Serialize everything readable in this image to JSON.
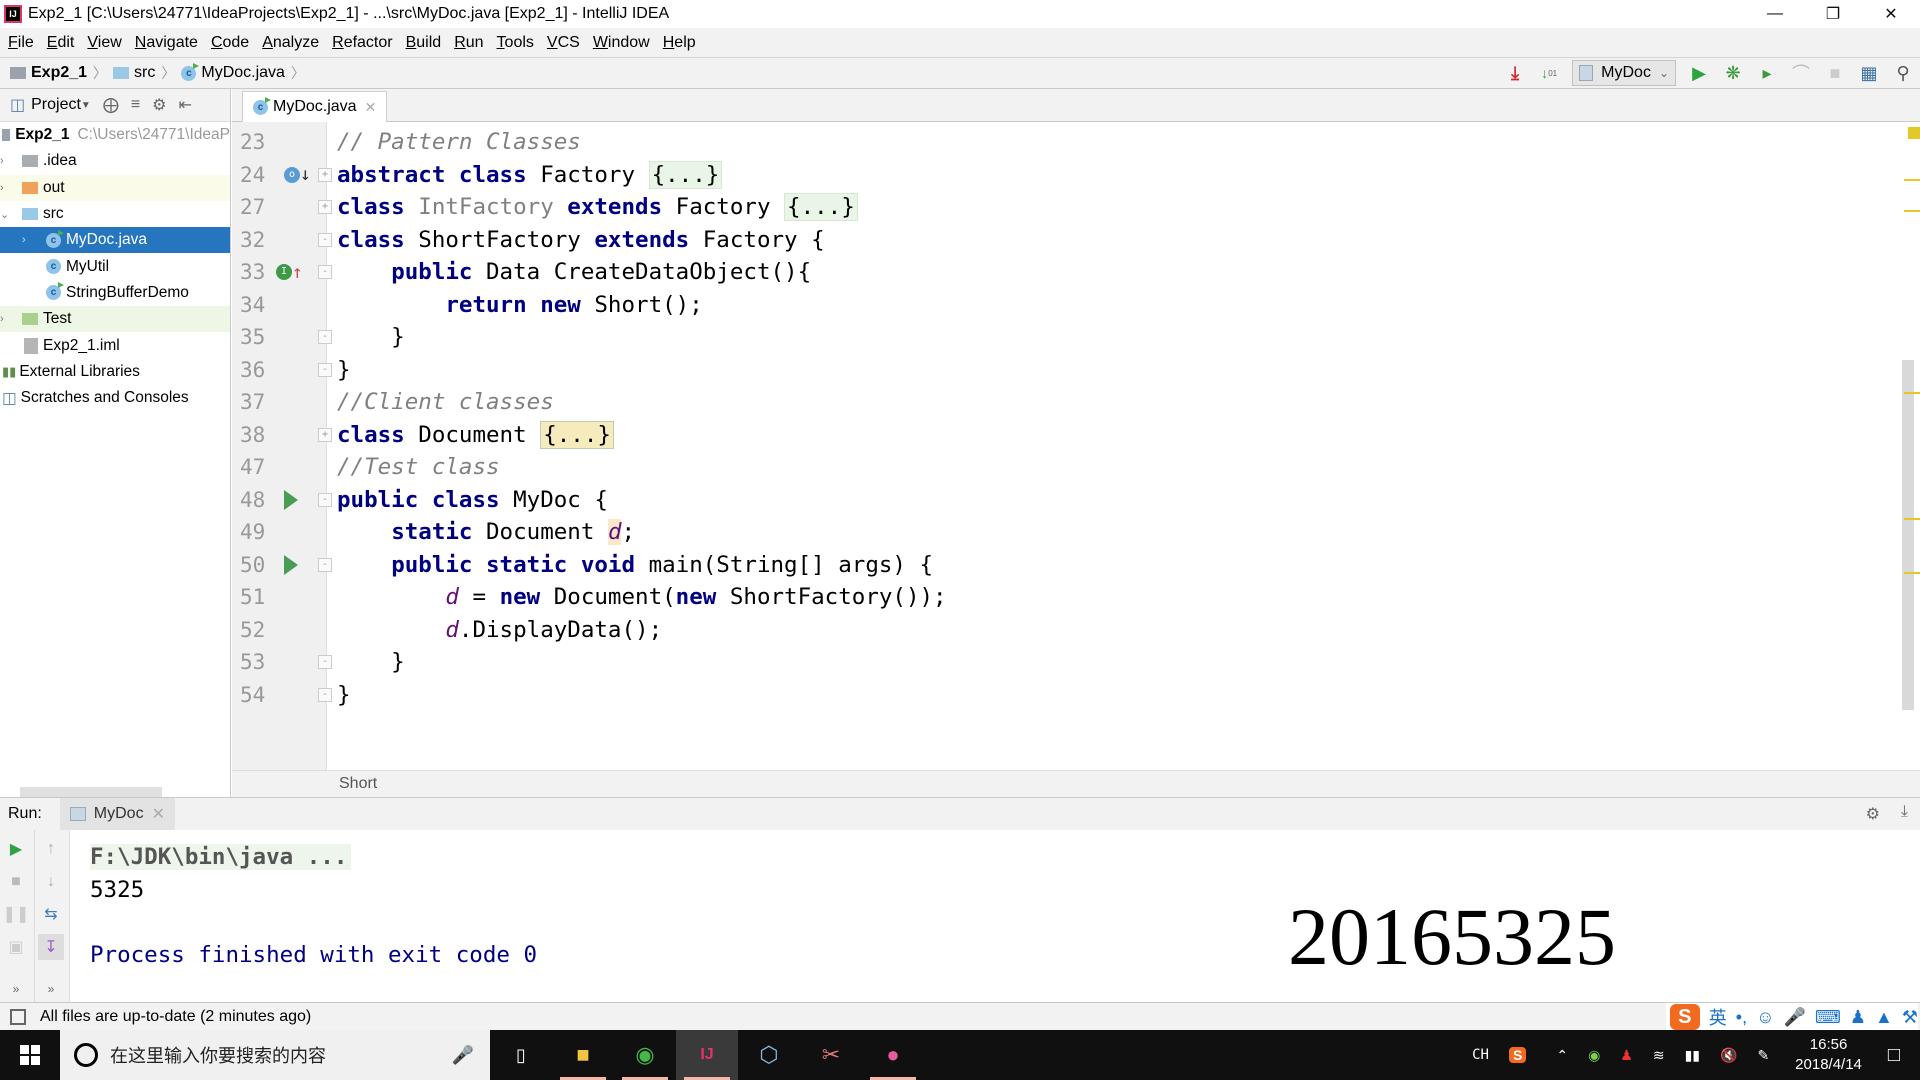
{
  "window": {
    "title": "Exp2_1 [C:\\Users\\24771\\IdeaProjects\\Exp2_1] - ...\\src\\MyDoc.java [Exp2_1] - IntelliJ IDEA",
    "controls": [
      "minimize",
      "restore",
      "close"
    ]
  },
  "menu": [
    "File",
    "Edit",
    "View",
    "Navigate",
    "Code",
    "Analyze",
    "Refactor",
    "Build",
    "Run",
    "Tools",
    "VCS",
    "Window",
    "Help"
  ],
  "breadcrumb": {
    "items": [
      "Exp2_1",
      "src",
      "MyDoc.java"
    ]
  },
  "toolbar": {
    "run_config": "MyDoc",
    "icons": [
      "build-icon",
      "sort-icon",
      "run-icon",
      "debug-icon",
      "coverage-icon",
      "profile-icon",
      "stop-icon",
      "project-structure-icon",
      "search-icon"
    ]
  },
  "project_panel": {
    "header": "Project",
    "tree": [
      {
        "label": "Exp2_1",
        "path": "C:\\Users\\24771\\IdeaP",
        "type": "project",
        "expanded": true
      },
      {
        "label": ".idea",
        "type": "folder"
      },
      {
        "label": "out",
        "type": "folder-excluded"
      },
      {
        "label": "src",
        "type": "folder-source",
        "expanded": true
      },
      {
        "label": "MyDoc.java",
        "type": "class",
        "selected": true
      },
      {
        "label": "MyUtil",
        "type": "class"
      },
      {
        "label": "StringBufferDemo",
        "type": "class"
      },
      {
        "label": "Test",
        "type": "folder-test"
      },
      {
        "label": "Exp2_1.iml",
        "type": "file"
      },
      {
        "label": "External Libraries",
        "type": "libraries"
      },
      {
        "label": "Scratches and Consoles",
        "type": "scratches"
      }
    ]
  },
  "editor": {
    "tab": "MyDoc.java",
    "lines": [
      {
        "n": "23",
        "text": "// Pattern Classes"
      },
      {
        "n": "24",
        "text": "abstract class Factory {...}"
      },
      {
        "n": "27",
        "text": "class IntFactory extends Factory {...}"
      },
      {
        "n": "32",
        "text": "class ShortFactory extends Factory {"
      },
      {
        "n": "33",
        "text": "    public Data CreateDataObject(){"
      },
      {
        "n": "34",
        "text": "        return new Short();"
      },
      {
        "n": "35",
        "text": "    }"
      },
      {
        "n": "36",
        "text": "}"
      },
      {
        "n": "37",
        "text": "//Client classes"
      },
      {
        "n": "38",
        "text": "class Document {...}"
      },
      {
        "n": "47",
        "text": "//Test class"
      },
      {
        "n": "48",
        "text": "public class MyDoc {"
      },
      {
        "n": "49",
        "text": "    static Document d;"
      },
      {
        "n": "50",
        "text": "    public static void main(String[] args) {"
      },
      {
        "n": "51",
        "text": "        d = new Document(new ShortFactory());"
      },
      {
        "n": "52",
        "text": "        d.DisplayData();"
      },
      {
        "n": "53",
        "text": "    }"
      },
      {
        "n": "54",
        "text": "}"
      }
    ],
    "breadcrumb": "Short"
  },
  "run_panel": {
    "label": "Run:",
    "tab": "MyDoc",
    "console": [
      "F:\\JDK\\bin\\java ...",
      "5325",
      "",
      "Process finished with exit code 0"
    ]
  },
  "overlay_text": "20165325",
  "status": {
    "message": "All files are up-to-date (2 minutes ago)"
  },
  "ime": {
    "logo": "S",
    "mode": "英",
    "punct": "•,"
  },
  "taskbar": {
    "search_placeholder": "在这里输入你要搜索的内容",
    "lang": "CH",
    "time": "16:56",
    "date": "2018/4/14"
  }
}
